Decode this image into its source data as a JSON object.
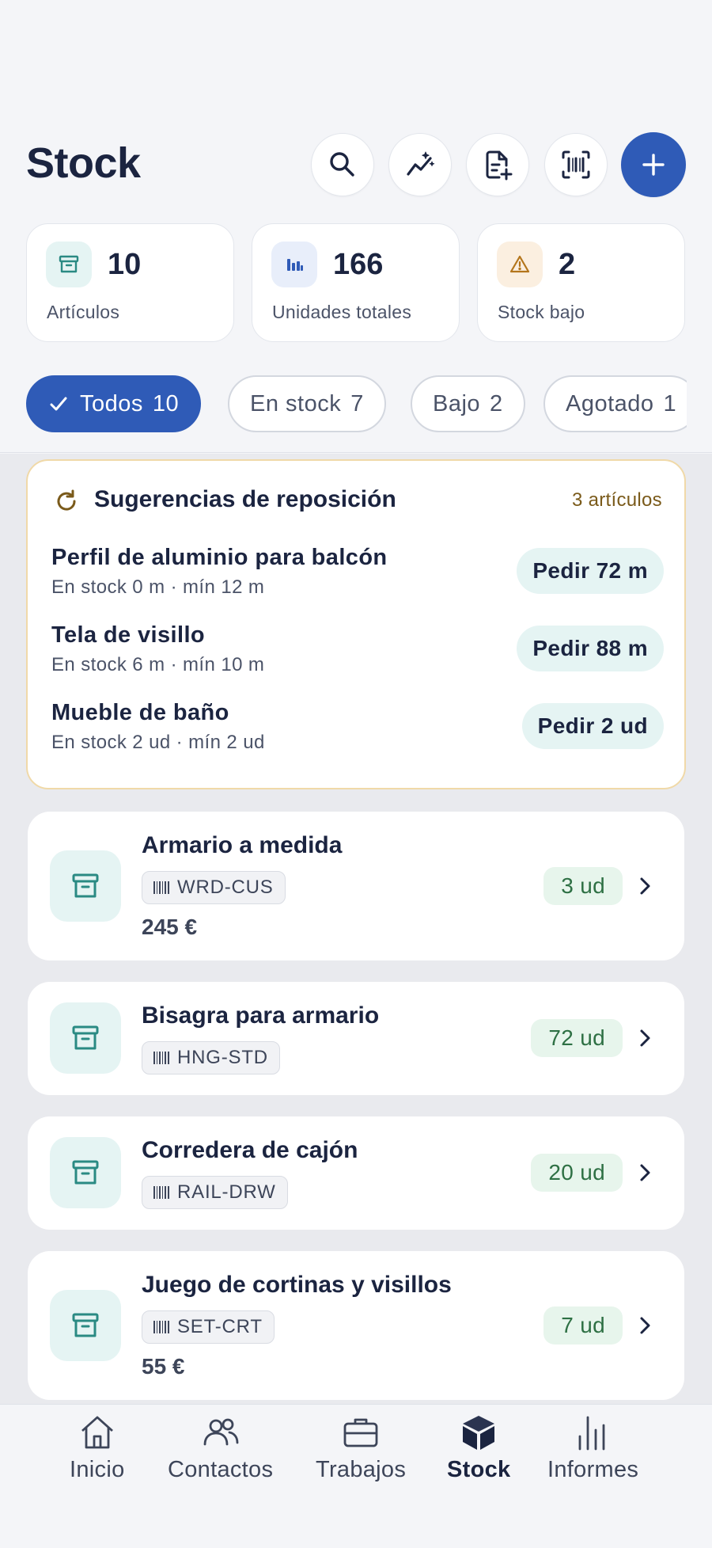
{
  "header": {
    "title": "Stock",
    "buttons": [
      {
        "icon": "search-icon"
      },
      {
        "icon": "sparkline-icon"
      },
      {
        "icon": "add-document-icon"
      },
      {
        "icon": "barcode-scan-icon"
      },
      {
        "icon": "plus-icon"
      }
    ],
    "accent": "#2f5bb7"
  },
  "stats": [
    {
      "value": "10",
      "label": "Artículos",
      "icon": "archive-icon",
      "color": "#2a8a83"
    },
    {
      "value": "166",
      "label": "Unidades totales",
      "icon": "bar-chart-icon",
      "color": "#2f5bb7"
    },
    {
      "value": "2",
      "label": "Stock bajo",
      "icon": "warning-icon",
      "color": "#b4761c"
    }
  ],
  "filters": [
    {
      "label": "Todos",
      "count": "10",
      "active": true
    },
    {
      "label": "En stock",
      "count": "7",
      "active": false
    },
    {
      "label": "Bajo",
      "count": "2",
      "active": false
    },
    {
      "label": "Agotado",
      "count": "1",
      "active": false
    }
  ],
  "suggestions": {
    "title": "Sugerencias de reposición",
    "count": "3 artículos",
    "items": [
      {
        "name": "Perfil de aluminio para balcón",
        "detail": "En stock 0 m · mín 12 m",
        "action": "Pedir 72 m"
      },
      {
        "name": "Tela de visillo",
        "detail": "En stock 6 m · mín 10 m",
        "action": "Pedir 88 m"
      },
      {
        "name": "Mueble de baño",
        "detail": "En stock 2 ud · mín 2 ud",
        "action": "Pedir 2 ud"
      }
    ]
  },
  "items": [
    {
      "name": "Armario a medida",
      "sku": "WRD-CUS",
      "price": "245 €",
      "qty": "3 ud"
    },
    {
      "name": "Bisagra para armario",
      "sku": "HNG-STD",
      "price": "",
      "qty": "72 ud"
    },
    {
      "name": "Corredera de cajón",
      "sku": "RAIL-DRW",
      "price": "",
      "qty": "20 ud"
    },
    {
      "name": "Juego de cortinas y visillos",
      "sku": "SET-CRT",
      "price": "55 €",
      "qty": "7 ud"
    }
  ],
  "nav": [
    {
      "label": "Inicio",
      "icon": "home-icon",
      "active": false
    },
    {
      "label": "Contactos",
      "icon": "contacts-icon",
      "active": false
    },
    {
      "label": "Trabajos",
      "icon": "briefcase-icon",
      "active": false
    },
    {
      "label": "Stock",
      "icon": "box-icon",
      "active": true
    },
    {
      "label": "Informes",
      "icon": "reports-icon",
      "active": false
    }
  ]
}
